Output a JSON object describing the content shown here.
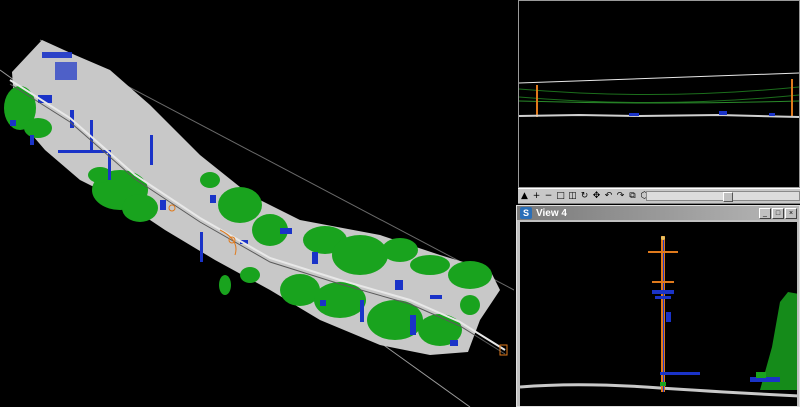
{
  "window4": {
    "title": "View 4",
    "app_icon_glyph": "S"
  },
  "toolbar": {
    "tools": [
      {
        "name": "pointer-icon",
        "glyph": "▲"
      },
      {
        "name": "zoom-in-icon",
        "glyph": "+"
      },
      {
        "name": "zoom-out-icon",
        "glyph": "−"
      },
      {
        "name": "window-area-icon",
        "glyph": "□"
      },
      {
        "name": "fit-view-icon",
        "glyph": "◫"
      },
      {
        "name": "rotate-icon",
        "glyph": "↻"
      },
      {
        "name": "pan-icon",
        "glyph": "✥"
      },
      {
        "name": "undo-view-icon",
        "glyph": "↶"
      },
      {
        "name": "redo-view-icon",
        "glyph": "↷"
      },
      {
        "name": "copy-view-icon",
        "glyph": "⧉"
      },
      {
        "name": "3d-cube-icon",
        "glyph": "⬡"
      },
      {
        "name": "camera-icon",
        "glyph": "◉"
      }
    ]
  },
  "colors": {
    "ground": "#c8c8c8",
    "vegetation": "#19a31e",
    "building": "#1a33c8",
    "pole": "#e07a1c",
    "wire": "#1c6e1c"
  }
}
